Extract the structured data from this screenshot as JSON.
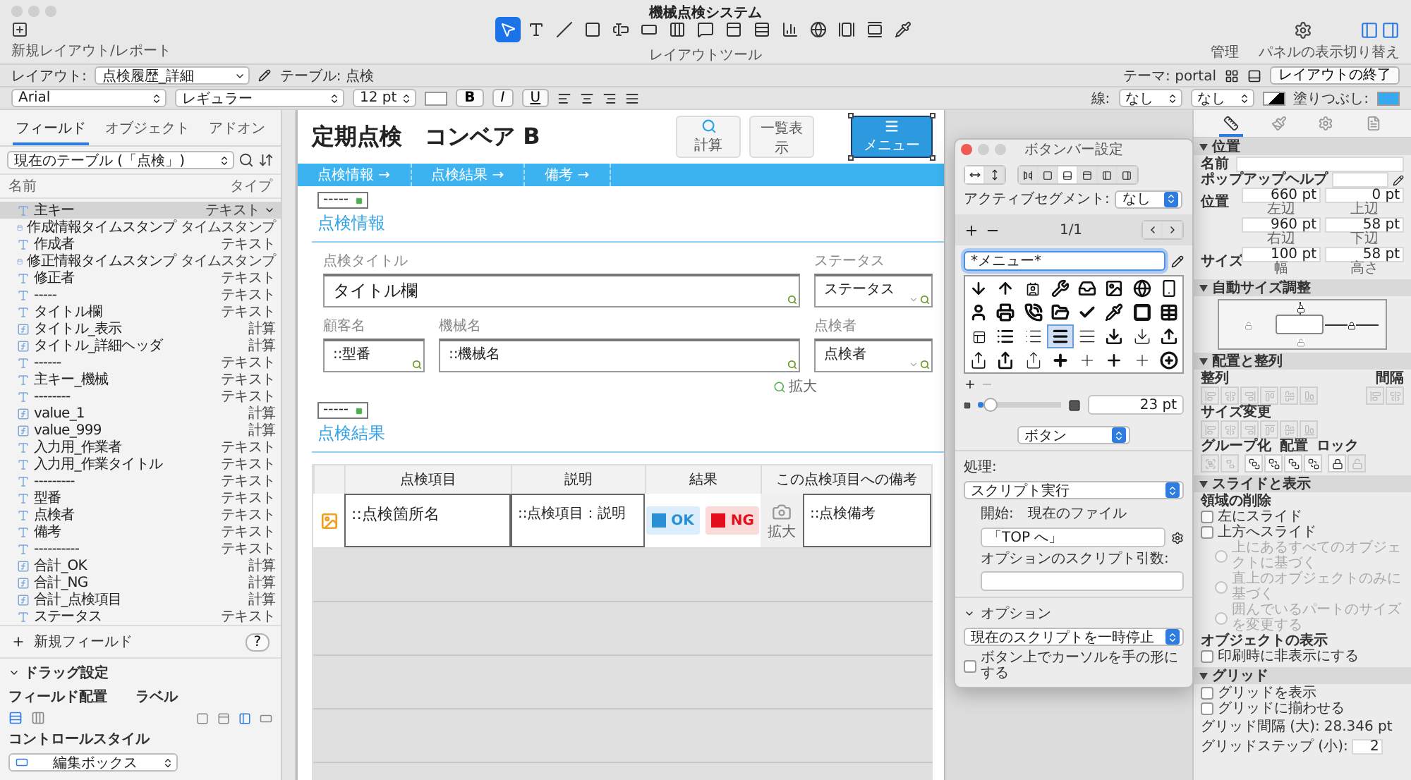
{
  "window": {
    "title": "機械点検システム"
  },
  "toolbar": {
    "new_layout_label": "新規レイアウト/レポート",
    "tools_label": "レイアウトツール",
    "manage_label": "管理",
    "panels_label": "パネルの表示切り替え",
    "tools": [
      {
        "kind": "pointer",
        "selected": true
      },
      {
        "kind": "text",
        "selected": false
      },
      {
        "kind": "line",
        "selected": false
      },
      {
        "kind": "rect",
        "selected": false
      },
      {
        "kind": "field",
        "selected": false
      },
      {
        "kind": "button",
        "selected": false
      },
      {
        "kind": "buttonbar",
        "selected": false
      },
      {
        "kind": "popover",
        "selected": false
      },
      {
        "kind": "tab",
        "selected": false
      },
      {
        "kind": "portal",
        "selected": false
      },
      {
        "kind": "chart",
        "selected": false
      },
      {
        "kind": "web",
        "selected": false
      },
      {
        "kind": "slide",
        "selected": false
      },
      {
        "kind": "slide2",
        "selected": false
      },
      {
        "kind": "eyedropper",
        "selected": false
      }
    ]
  },
  "layout_bar": {
    "layout_label": "レイアウト:",
    "layout": "点検履歴_詳細",
    "table": "テーブル: 点検",
    "theme": "テーマ: portal",
    "exit_button": "レイアウトの終了"
  },
  "format_bar": {
    "font": "Arial",
    "style": "レギュラー",
    "size": "12 pt",
    "bold": "B",
    "italic": "I",
    "underline": "U",
    "line_label": "線:",
    "line_style": "なし",
    "line_width": "なし",
    "fill_label": "塗りつぶし:"
  },
  "left_panel": {
    "tabs": [
      {
        "label": "フィールド",
        "selected": true
      },
      {
        "label": "オブジェクト",
        "selected": false
      },
      {
        "label": "アドオン",
        "selected": false
      }
    ],
    "table_select": "現在のテーブル (「点検」)",
    "columns": [
      "名前",
      "タイプ"
    ],
    "fields": [
      {
        "name": "主キー",
        "type": "テキスト",
        "kind": "text",
        "selected": true
      },
      {
        "name": "作成情報タイムスタンプ",
        "type": "タイムスタンプ",
        "kind": "timestamp",
        "selected": false
      },
      {
        "name": "作成者",
        "type": "テキスト",
        "kind": "text",
        "selected": false
      },
      {
        "name": "修正情報タイムスタンプ",
        "type": "タイムスタンプ",
        "kind": "timestamp",
        "selected": false
      },
      {
        "name": "修正者",
        "type": "テキスト",
        "kind": "text",
        "selected": false
      },
      {
        "name": "-----",
        "type": "テキスト",
        "kind": "text",
        "selected": false
      },
      {
        "name": "タイトル欄",
        "type": "テキスト",
        "kind": "text",
        "selected": false
      },
      {
        "name": "タイトル_表示",
        "type": "計算",
        "kind": "calc",
        "selected": false
      },
      {
        "name": "タイトル_詳細ヘッダ",
        "type": "計算",
        "kind": "calc",
        "selected": false
      },
      {
        "name": "------",
        "type": "テキスト",
        "kind": "text",
        "selected": false
      },
      {
        "name": "主キー_機械",
        "type": "テキスト",
        "kind": "text",
        "selected": false
      },
      {
        "name": "--------",
        "type": "テキスト",
        "kind": "text",
        "selected": false
      },
      {
        "name": "value_1",
        "type": "計算",
        "kind": "calc",
        "selected": false
      },
      {
        "name": "value_999",
        "type": "計算",
        "kind": "calc",
        "selected": false
      },
      {
        "name": "入力用_作業者",
        "type": "テキスト",
        "kind": "text",
        "selected": false
      },
      {
        "name": "入力用_作業タイトル",
        "type": "テキスト",
        "kind": "text",
        "selected": false
      },
      {
        "name": "---------",
        "type": "テキスト",
        "kind": "text",
        "selected": false
      },
      {
        "name": "型番",
        "type": "テキスト",
        "kind": "text",
        "selected": false
      },
      {
        "name": "点検者",
        "type": "テキスト",
        "kind": "text",
        "selected": false
      },
      {
        "name": "備考",
        "type": "テキスト",
        "kind": "text",
        "selected": false
      },
      {
        "name": "----------",
        "type": "テキスト",
        "kind": "text",
        "selected": false
      },
      {
        "name": "合計_OK",
        "type": "計算",
        "kind": "calc",
        "selected": false
      },
      {
        "name": "合計_NG",
        "type": "計算",
        "kind": "calc",
        "selected": false
      },
      {
        "name": "合計_点検項目",
        "type": "計算",
        "kind": "calc",
        "selected": false
      },
      {
        "name": "ステータス",
        "type": "テキスト",
        "kind": "text",
        "selected": false
      }
    ],
    "new_field": "新規フィールド",
    "help": "?",
    "drag": {
      "title": "ドラッグ設定",
      "placement_label": "フィールド配置",
      "label_label": "ラベル",
      "control_style_label": "コントロールスタイル",
      "control_style": "編集ボックス"
    }
  },
  "canvas": {
    "title": "定期点検　コンベア B",
    "buttons": [
      {
        "label": "計算",
        "kind": "search",
        "selected": false
      },
      {
        "label": "一覧表示",
        "kind": "list",
        "selected": false
      },
      {
        "label": "メニュー",
        "kind": "menu",
        "selected": true
      }
    ],
    "nav": [
      "点検情報 →",
      "点検結果 →",
      "備考 →"
    ],
    "info": {
      "badge": "-----",
      "title": "点検情報",
      "title_row": {
        "title_field": {
          "label": "点検タイトル",
          "value": "タイトル欄",
          "kind": "wide"
        },
        "status_field": {
          "label": "ステータス",
          "value": "ステータス",
          "kind": "dropdown"
        }
      },
      "detail_row": {
        "customer_field": {
          "label": "顧客名",
          "value": "::型番",
          "kind": "short"
        },
        "machine_field": {
          "label": "機械名",
          "value": "::機械名",
          "kind": "wide"
        },
        "inspector_field": {
          "label": "点検者",
          "value": "点検者",
          "kind": "dropdown"
        }
      },
      "zoom_link": "拡大"
    },
    "results": {
      "badge": "-----",
      "title": "点検結果",
      "columns": [
        "点検項目",
        "説明",
        "結果",
        "この点検項目への備考"
      ],
      "item": "::点検箇所名",
      "description": "::点検項目：説明",
      "result_buttons": [
        {
          "label": "OK",
          "color": "#2b8fd6"
        },
        {
          "label": "NG",
          "color": "#e3101b"
        }
      ],
      "zoom_link": "拡大",
      "note": "::点検備考"
    }
  },
  "button_bar_popover": {
    "title": "ボタンバー設定",
    "orientation": [
      {
        "kind": "horizontal",
        "selected": true
      },
      {
        "kind": "vertical",
        "selected": false
      }
    ],
    "icon_position": [
      {
        "kind": "none",
        "selected": false
      },
      {
        "kind": "icon-only",
        "selected": false
      },
      {
        "kind": "top",
        "selected": true
      },
      {
        "kind": "bottom",
        "selected": false
      },
      {
        "kind": "left",
        "selected": false
      },
      {
        "kind": "right",
        "selected": false
      }
    ],
    "active_segment_label": "アクティブセグメント:",
    "active_segment": "なし",
    "page": "1/1",
    "label_field": "*メニュー*",
    "icons": [
      {
        "kind": "arrow-down",
        "selected": false
      },
      {
        "kind": "arrow-up",
        "selected": false
      },
      {
        "kind": "image-box",
        "selected": false
      },
      {
        "kind": "wrench",
        "selected": false
      },
      {
        "kind": "inbox",
        "selected": false
      },
      {
        "kind": "picture",
        "selected": false
      },
      {
        "kind": "globe",
        "selected": false
      },
      {
        "kind": "phone",
        "selected": false
      },
      {
        "kind": "person",
        "selected": false
      },
      {
        "kind": "printer",
        "selected": false
      },
      {
        "kind": "call",
        "selected": false
      },
      {
        "kind": "folder",
        "selected": false
      },
      {
        "kind": "check",
        "selected": false
      },
      {
        "kind": "eyedropper",
        "selected": false
      },
      {
        "kind": "square",
        "selected": false
      },
      {
        "kind": "table",
        "selected": false
      },
      {
        "kind": "table-outline",
        "selected": false
      },
      {
        "kind": "list",
        "selected": false
      },
      {
        "kind": "list-thin",
        "selected": false
      },
      {
        "kind": "menu",
        "selected": true
      },
      {
        "kind": "menu-thin",
        "selected": false
      },
      {
        "kind": "download",
        "selected": false
      },
      {
        "kind": "download-thin",
        "selected": false
      },
      {
        "kind": "upload",
        "selected": false
      },
      {
        "kind": "share",
        "selected": false
      },
      {
        "kind": "share-bold",
        "selected": false
      },
      {
        "kind": "share-thin",
        "selected": false
      },
      {
        "kind": "plus-bold",
        "selected": false
      },
      {
        "kind": "plus-thin",
        "selected": false
      },
      {
        "kind": "plus",
        "selected": false
      },
      {
        "kind": "plus-thin",
        "selected": false
      },
      {
        "kind": "plus-circle",
        "selected": false
      }
    ],
    "icon_size": {
      "level": 0.15,
      "reading": "23 pt"
    },
    "type": "ボタン",
    "action_label": "処理:",
    "action": "スクリプト実行",
    "start": "開始:　現在のファイル",
    "script": "「TOP へ」",
    "param_label": "オプションのスクリプト引数:",
    "options_label": "オプション",
    "options_select": "現在のスクリプトを一時停止",
    "hand_cursor": {
      "label": "ボタン上でカーソルを手の形にする",
      "checked": false
    }
  },
  "inspector": {
    "tabs": [
      {
        "kind": "position",
        "selected": true
      },
      {
        "kind": "style",
        "selected": false
      },
      {
        "kind": "appearance",
        "selected": false
      },
      {
        "kind": "data",
        "selected": false
      }
    ],
    "position": {
      "title": "位置",
      "name_label": "名前",
      "popup_help_label": "ポップアップヘルプ",
      "position_label": "位置",
      "coords": [
        {
          "value": "660 pt",
          "label": "左辺"
        },
        {
          "value": "0 pt",
          "label": "上辺"
        },
        {
          "value": "960 pt",
          "label": "右辺"
        },
        {
          "value": "58 pt",
          "label": "下辺"
        }
      ],
      "size_label": "サイズ",
      "size": [
        {
          "value": "100 pt",
          "label": "幅"
        },
        {
          "value": "58 pt",
          "label": "高さ"
        }
      ]
    },
    "autosize": {
      "title": "自動サイズ調整",
      "anchors": [
        {
          "kind": "top",
          "on": true
        },
        {
          "kind": "right",
          "on": true
        },
        {
          "kind": "bottom",
          "on": false
        },
        {
          "kind": "left",
          "on": false
        }
      ]
    },
    "arrange": {
      "title": "配置と整列",
      "align_label": "整列",
      "spacing_label": "間隔",
      "resize_label": "サイズ変更",
      "group_label": "グループ化",
      "order_label": "配置",
      "lock_label": "ロック"
    },
    "slide": {
      "title": "スライドと表示",
      "remove_label": "領域の削除",
      "options": [
        {
          "label": "左にスライド",
          "checked": false
        },
        {
          "label": "上方へスライド",
          "checked": false
        }
      ],
      "sub_options": [
        {
          "label": "上にあるすべてのオブジェクトに基づく",
          "selected": false,
          "disabled": true
        },
        {
          "label": "直上のオブジェクトのみに基づく",
          "selected": false,
          "disabled": true
        },
        {
          "label": "囲んでいるパートのサイズを変更する",
          "selected": false,
          "disabled": true
        }
      ],
      "visibility_label": "オブジェクトの表示",
      "hide_print": {
        "label": "印刷時に非表示にする",
        "checked": false
      }
    },
    "grid": {
      "title": "グリッド",
      "options": [
        {
          "label": "グリッドを表示",
          "checked": false
        },
        {
          "label": "グリッドに揃わせる",
          "checked": false
        }
      ],
      "major_label": "グリッド間隔 (大):",
      "major": "28.346 pt",
      "minor_label": "グリッドステップ (小):",
      "minor": "2"
    }
  }
}
